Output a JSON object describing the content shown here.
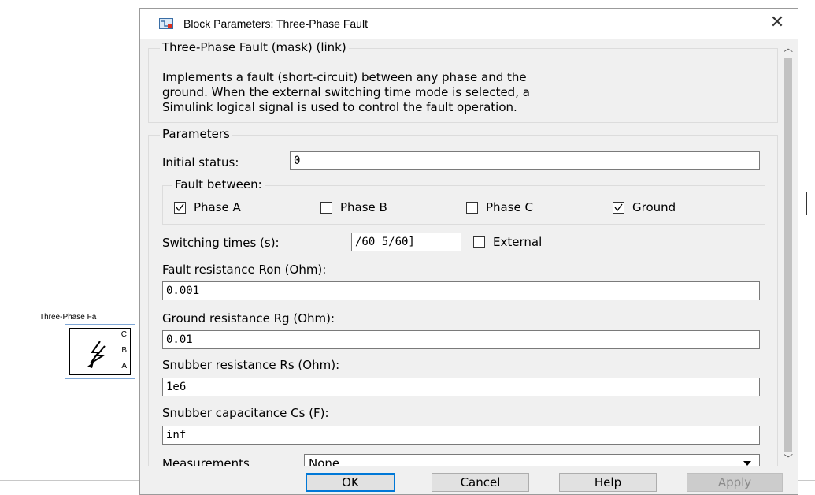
{
  "background": {
    "block_label": "Three-Phase Fa",
    "ports": [
      "C",
      "B",
      "A"
    ]
  },
  "dialog": {
    "title": "Block Parameters: Three-Phase Fault",
    "mask_title": "Three-Phase Fault (mask) (link)",
    "description_lines": [
      "Implements a fault (short-circuit) between any phase and the",
      "ground. When the external switching time mode is selected, a",
      "Simulink logical signal is used to control the fault operation."
    ],
    "parameters_label": "Parameters",
    "initial_status": {
      "label": "Initial status:",
      "value": "0"
    },
    "fault_between": {
      "label": "Fault between:",
      "options": [
        {
          "label": "Phase A",
          "checked": true
        },
        {
          "label": "Phase B",
          "checked": false
        },
        {
          "label": "Phase C",
          "checked": false
        },
        {
          "label": "Ground",
          "checked": true
        }
      ]
    },
    "switching_times": {
      "label": "Switching times (s):",
      "value": "/60  5/60]",
      "external_label": "External",
      "external_checked": false
    },
    "fault_resistance": {
      "label": "Fault resistance Ron (Ohm):",
      "value": "0.001"
    },
    "ground_resistance": {
      "label": "Ground resistance Rg (Ohm):",
      "value": "0.01"
    },
    "snubber_resistance": {
      "label": "Snubber resistance Rs (Ohm):",
      "value": "1e6"
    },
    "snubber_capacitance": {
      "label": "Snubber capacitance Cs (F):",
      "value": "inf"
    },
    "measurements": {
      "label": "Measurements",
      "value": "None"
    },
    "buttons": {
      "ok": "OK",
      "cancel": "Cancel",
      "help": "Help",
      "apply": "Apply"
    }
  },
  "colors": {
    "accent": "#0078d7",
    "window_bg": "#f0f0f0"
  },
  "icons": {
    "title_icon": "simulink-block-icon",
    "close": "close-icon",
    "fault": "lightning-icon"
  }
}
